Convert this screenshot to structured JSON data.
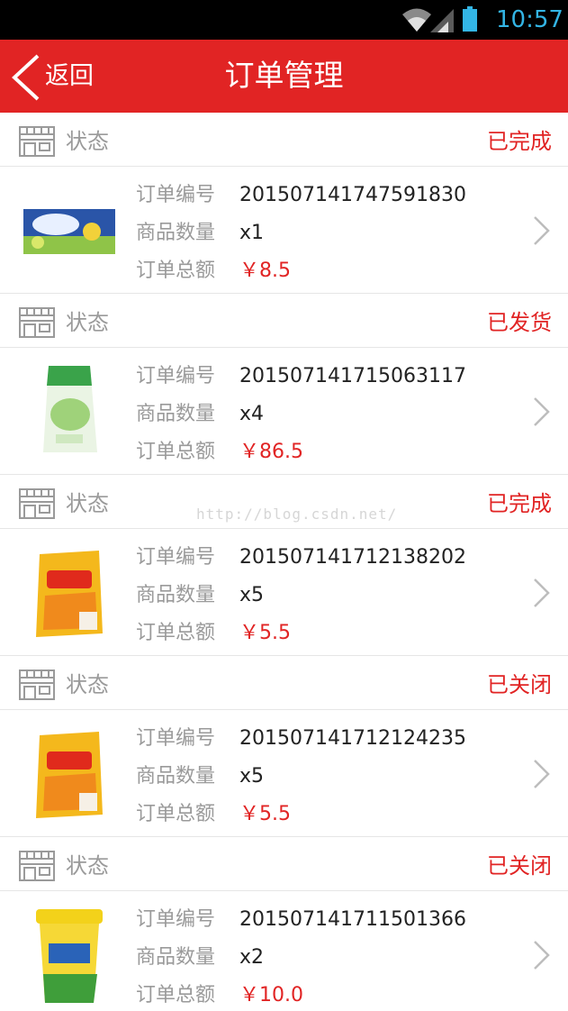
{
  "status_bar": {
    "time": "10:57",
    "accent": "#33b5e5"
  },
  "nav": {
    "back_label": "返回",
    "title": "订单管理",
    "color": "#e12424"
  },
  "labels": {
    "status": "状态",
    "order_no": "订单编号",
    "quantity": "商品数量",
    "total": "订单总额"
  },
  "orders": [
    {
      "status": "已完成",
      "order_no": "201507141747591830",
      "quantity": "x1",
      "total": "￥8.5",
      "thumb": "gum-pack-image"
    },
    {
      "status": "已发货",
      "order_no": "201507141715063117",
      "quantity": "x4",
      "total": "￥86.5",
      "thumb": "milk-bag-image"
    },
    {
      "status": "已完成",
      "order_no": "201507141712138202",
      "quantity": "x5",
      "total": "￥5.5",
      "thumb": "snack-bag-image"
    },
    {
      "status": "已关闭",
      "order_no": "201507141712124235",
      "quantity": "x5",
      "total": "￥5.5",
      "thumb": "snack-bag-image"
    },
    {
      "status": "已关闭",
      "order_no": "201507141711501366",
      "quantity": "x2",
      "total": "￥10.0",
      "thumb": "drink-cup-image"
    }
  ],
  "watermark": "http://blog.csdn.net/"
}
